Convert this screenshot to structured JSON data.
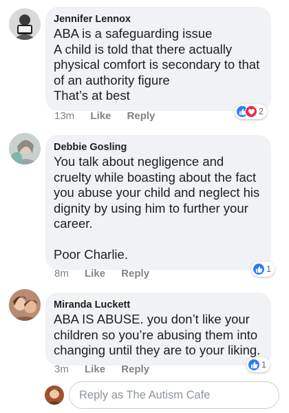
{
  "comments": [
    {
      "author": "Jennifer Lennox",
      "text": "ABA is a safeguarding issue\nA child is told that there actually physical comfort is secondary to that of an authority figure\nThat’s at best",
      "time": "13m",
      "like_label": "Like",
      "reply_label": "Reply",
      "reactions": [
        "like-icon",
        "love-icon"
      ],
      "reaction_count": "2"
    },
    {
      "author": "Debbie Gosling",
      "text": "You talk about negligence and cruelty while boasting about the fact you abuse your child and neglect his dignity by using him to further your career.\n\nPoor Charlie.",
      "time": "8m",
      "like_label": "Like",
      "reply_label": "Reply",
      "reactions": [
        "like-icon"
      ],
      "reaction_count": "1"
    },
    {
      "author": "Miranda Luckett",
      "text": "ABA IS ABUSE. you don’t like your children so you’re abusing them into changing until they are to your liking.",
      "time": "3m",
      "like_label": "Like",
      "reply_label": "Reply",
      "reactions": [
        "like-icon"
      ],
      "reaction_count": "1"
    }
  ],
  "reply_box": {
    "placeholder": "Reply as The Autism Cafe"
  },
  "colors": {
    "bubble": "#f0f2f5",
    "like_blue": "#2d7cf6",
    "love_red": "#f0284a",
    "meta_grey": "#7f8389"
  }
}
